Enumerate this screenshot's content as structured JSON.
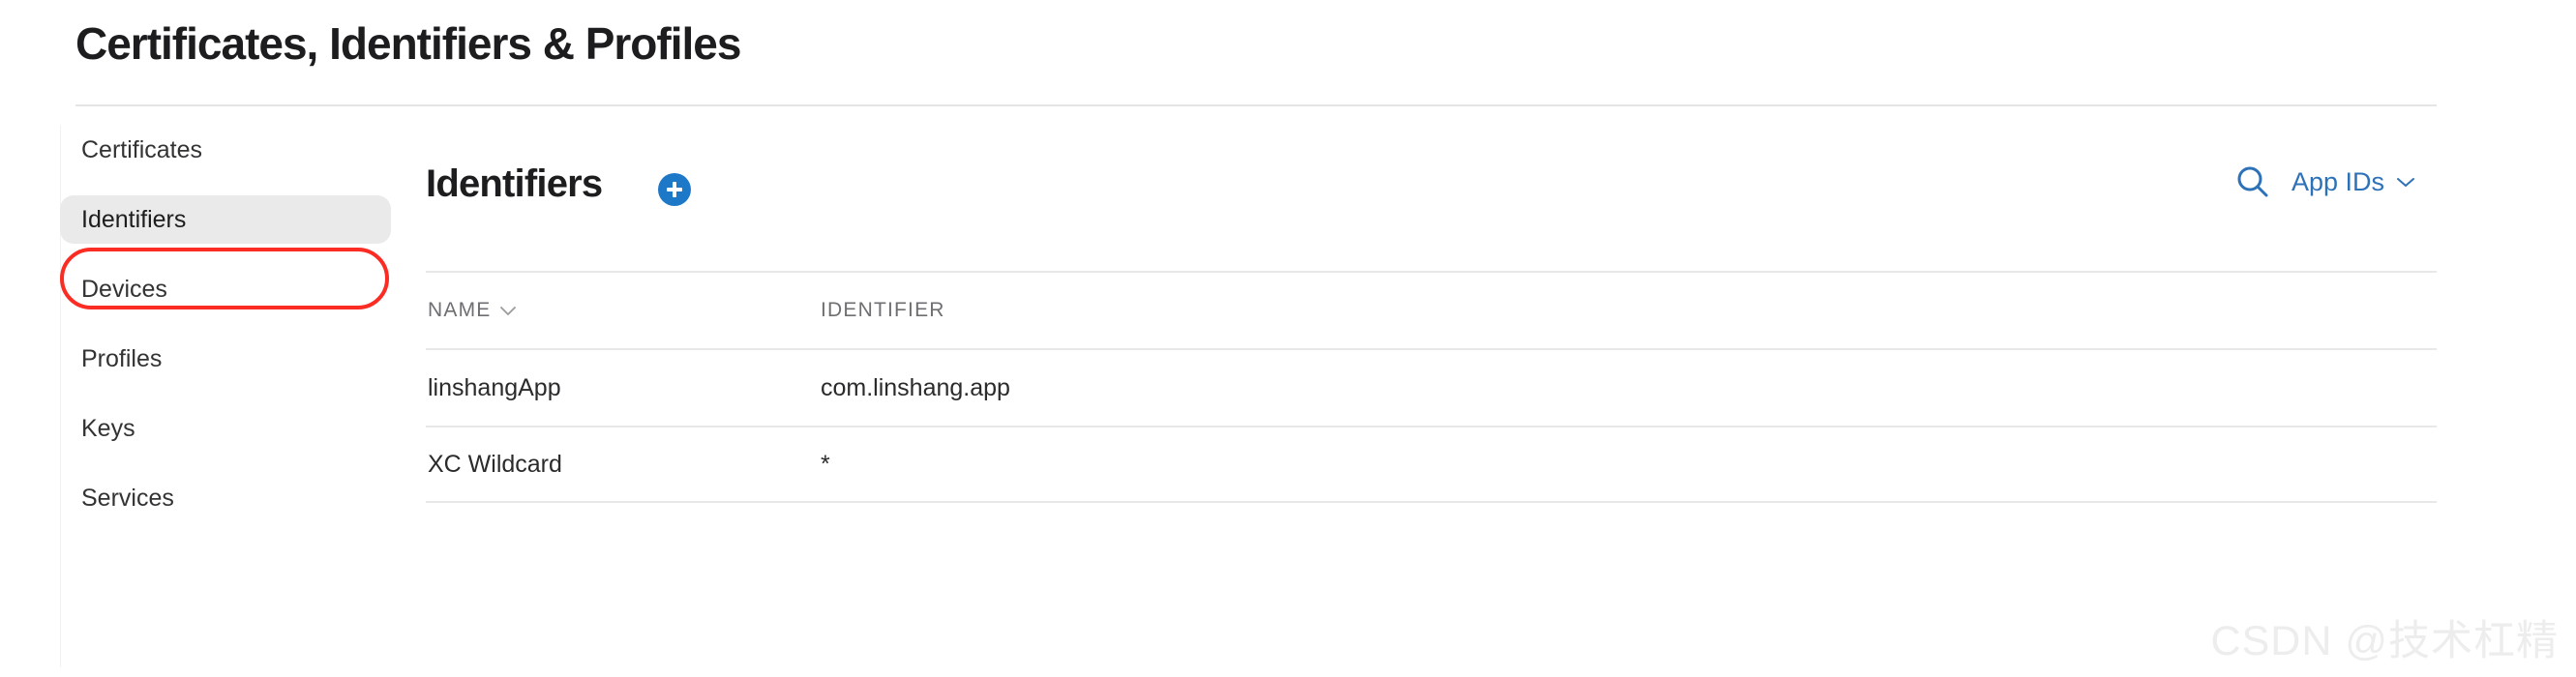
{
  "page": {
    "title": "Certificates, Identifiers & Profiles"
  },
  "sidebar": {
    "items": [
      {
        "label": "Certificates",
        "selected": false
      },
      {
        "label": "Identifiers",
        "selected": true
      },
      {
        "label": "Devices",
        "selected": false
      },
      {
        "label": "Profiles",
        "selected": false
      },
      {
        "label": "Keys",
        "selected": false
      },
      {
        "label": "Services",
        "selected": false
      }
    ],
    "selected_label": "Identifiers",
    "annotation_color": "#fb2c23",
    "selected_bg": "#eaeaea"
  },
  "content": {
    "section_title": "Identifiers",
    "add_button": {
      "icon": "plus-icon",
      "color": "#1d78c8"
    },
    "search": {
      "icon": "search-icon",
      "color": "#2d72b8"
    },
    "filter": {
      "selected": "App IDs",
      "chevron": "chevron-down-icon",
      "color": "#2d72b8"
    },
    "table": {
      "columns": [
        {
          "label": "NAME",
          "sortable": true
        },
        {
          "label": "IDENTIFIER",
          "sortable": false
        }
      ],
      "rows": [
        {
          "name": "linshangApp",
          "identifier": "com.linshang.app"
        },
        {
          "name": "XC Wildcard",
          "identifier": "*"
        }
      ]
    }
  },
  "watermark": {
    "text": "CSDN @技术杠精"
  }
}
